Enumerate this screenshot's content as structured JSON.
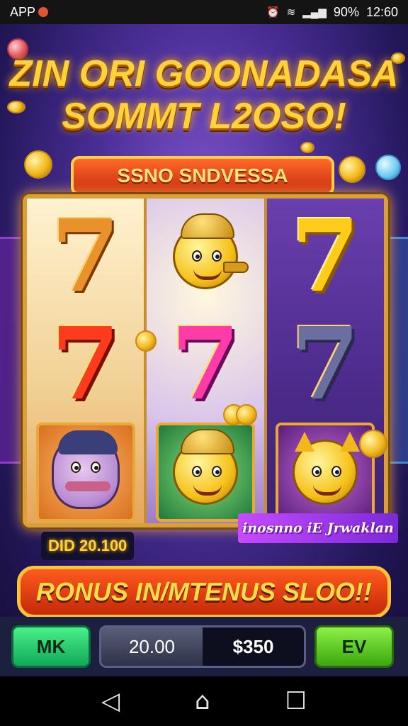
{
  "status_bar": {
    "app_label": "APP",
    "battery": "90%",
    "time": "12:60"
  },
  "game": {
    "headline_line1": "ZIN ORI GOONADASA",
    "headline_line2": "SOMMT L2OSO!",
    "top_banner": "SSNO SNDVESSA",
    "reels": [
      [
        {
          "type": "seven",
          "color": "#e9912a",
          "label": "7"
        },
        {
          "type": "seven",
          "color": "#ff3b1e",
          "label": "7"
        },
        {
          "type": "character",
          "icon": "mustache-man-icon"
        }
      ],
      [
        {
          "type": "character",
          "icon": "horn-duck-icon"
        },
        {
          "type": "seven",
          "color": "#ff3ba8",
          "label": "7"
        },
        {
          "type": "character",
          "icon": "helmet-duck-icon"
        }
      ],
      [
        {
          "type": "seven",
          "color": "#ffcc1a",
          "label": "7"
        },
        {
          "type": "seven",
          "color": "#6b6fa0",
          "label": "7"
        },
        {
          "type": "character",
          "icon": "cat-duck-icon"
        }
      ]
    ],
    "win_amount": "DID 20.100",
    "bonus_caption": "inosnno iE Jrwaklan",
    "bonus_banner": "RONUS IN/MTENUS SLOO!!"
  },
  "controls": {
    "min_label": "MK",
    "bet_value": "20.00",
    "balance_value": "$350",
    "max_label": "EV"
  },
  "nav": {
    "back_icon": "◁",
    "home_icon": "⌂",
    "recents_icon": "☐"
  },
  "colors": {
    "accent_gold": "#ffd23a",
    "banner_red": "#d8340e",
    "min_green": "#12a85a",
    "max_green": "#3aa810"
  }
}
